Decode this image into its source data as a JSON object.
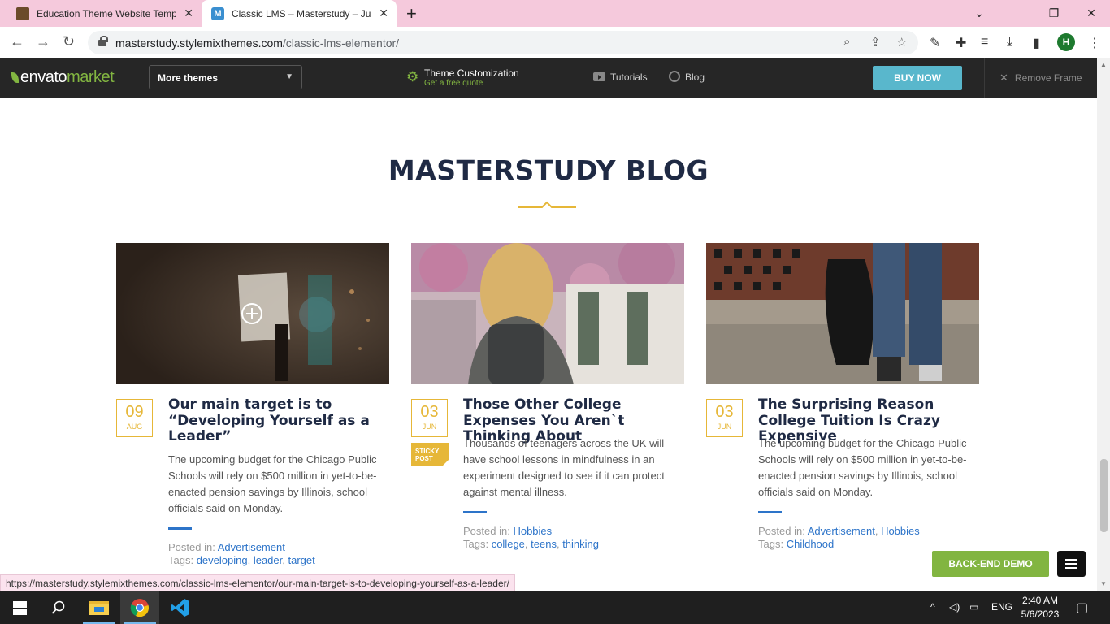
{
  "browser": {
    "tabs": [
      {
        "title": "Education Theme Website Templ",
        "favicon": "book-icon"
      },
      {
        "title": "Classic LMS – Masterstudy – Just",
        "favicon": "M"
      }
    ],
    "url_host": "masterstudy.stylemixthemes.com",
    "url_path": "/classic-lms-elementor/",
    "profile_initial": "H",
    "status_url": "https://masterstudy.stylemixthemes.com/classic-lms-elementor/our-main-target-is-to-developing-yourself-as-a-leader/"
  },
  "envato": {
    "logo_main": "envato",
    "logo_market": "market",
    "more_themes": "More themes",
    "theme_customization": "Theme Customization",
    "free_quote": "Get a free quote",
    "tutorials": "Tutorials",
    "blog": "Blog",
    "buy_now": "BUY NOW",
    "remove_frame": "Remove Frame",
    "colors": {
      "bar": "#262626",
      "green": "#82b541",
      "buy": "#59b7cc"
    }
  },
  "page": {
    "heading": "MASTERSTUDY BLOG",
    "accent_color": "#e6b738",
    "link_color": "#2d74c9",
    "posts": [
      {
        "day": "09",
        "month": "AUG",
        "title": "Our main target is to “Developing Yourself as a Leader”",
        "excerpt": "The upcoming budget for the Chicago Public Schools will rely on $500 million in yet-to-be-enacted pension savings by Illinois, school officials said on Monday.",
        "posted_label": "Posted in:",
        "categories": [
          "Advertisement"
        ],
        "tags_label": "Tags:",
        "tags": [
          "developing",
          "leader",
          "target"
        ]
      },
      {
        "day": "03",
        "month": "JUN",
        "sticky_line1": "STICKY",
        "sticky_line2": "POST",
        "title": "Those Other College Expenses You Aren`t Thinking About",
        "excerpt": "Thousands of teenagers across the UK will have school lessons in mindfulness in an experiment designed to see if it can protect against mental illness.",
        "posted_label": "Posted in:",
        "categories": [
          "Hobbies"
        ],
        "tags_label": "Tags:",
        "tags": [
          "college",
          "teens",
          "thinking"
        ]
      },
      {
        "day": "03",
        "month": "JUN",
        "title": "The Surprising Reason College Tuition Is Crazy Expensive",
        "excerpt": "The upcoming budget for the Chicago Public Schools will rely on $500 million in yet-to-be-enacted pension savings by Illinois, school officials said on Monday.",
        "posted_label": "Posted in:",
        "categories": [
          "Advertisement",
          "Hobbies"
        ],
        "tags_label": "Tags:",
        "tags": [
          "Childhood"
        ]
      }
    ],
    "backend_demo": "BACK-END DEMO"
  },
  "taskbar": {
    "language": "ENG",
    "time": "2:40 AM",
    "date": "5/6/2023"
  }
}
